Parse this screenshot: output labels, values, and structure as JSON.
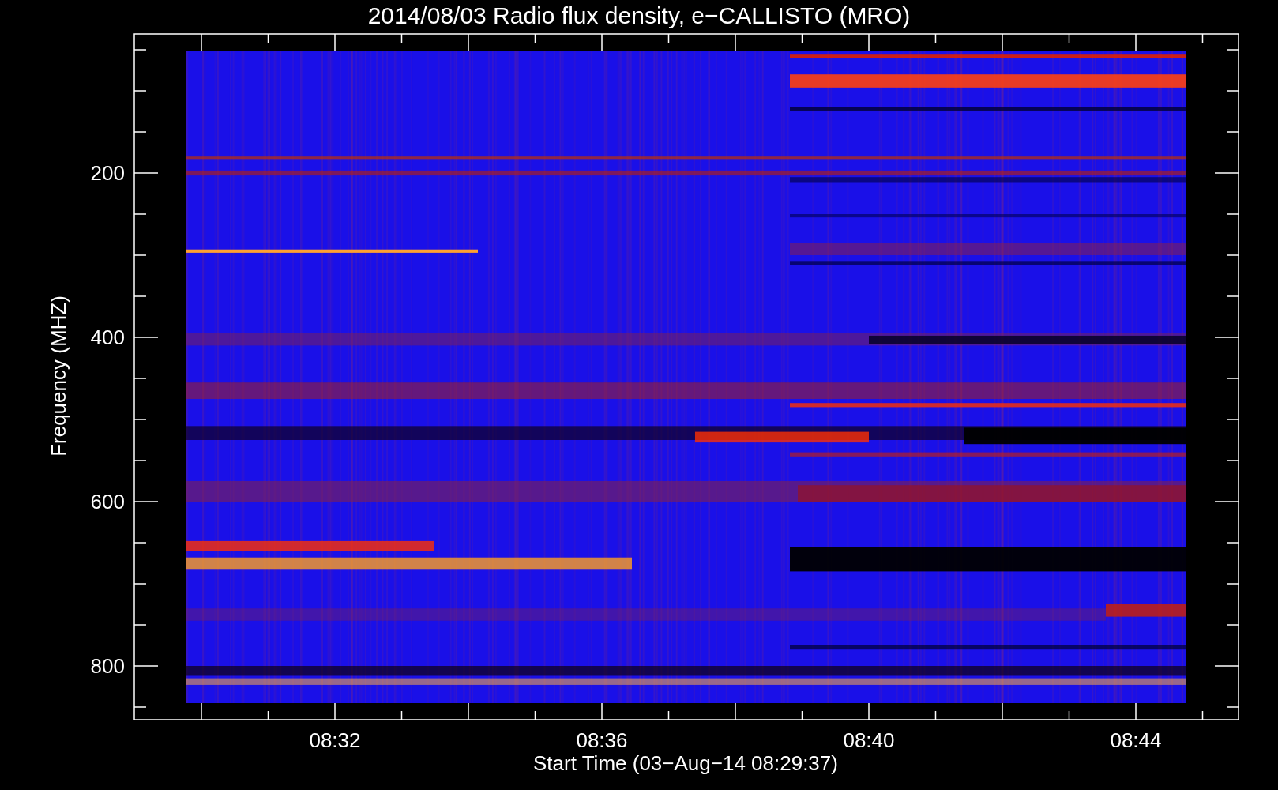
{
  "title": "2014/08/03  Radio flux density, e−CALLISTO (MRO)",
  "y_axis": {
    "label": "Frequency (MHZ)",
    "ticks": [
      "200",
      "400",
      "600",
      "800"
    ]
  },
  "x_axis": {
    "label": "Start Time (03−Aug−14 08:29:37)",
    "ticks": [
      "08:32",
      "08:36",
      "08:40",
      "08:44"
    ]
  }
}
